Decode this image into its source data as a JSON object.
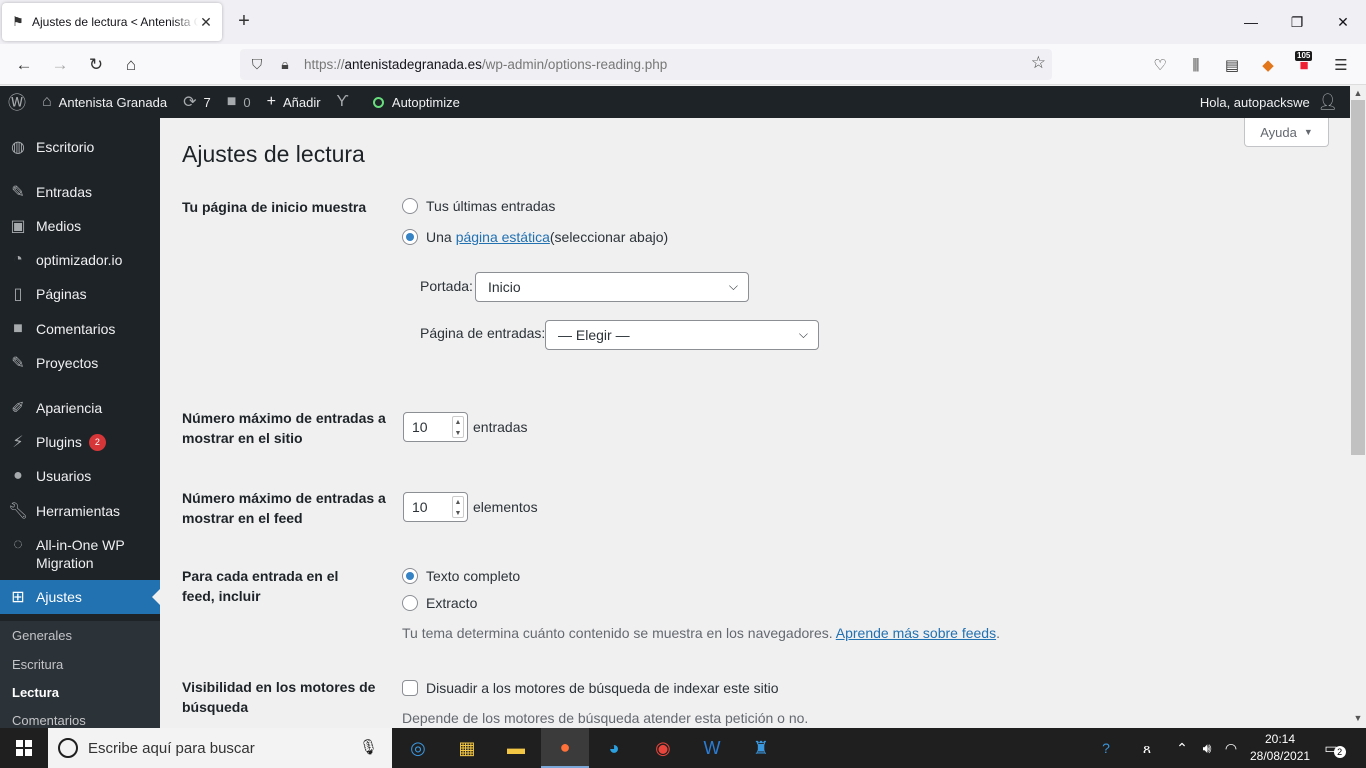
{
  "browser": {
    "tab_title": "Ajustes de lectura < Antenista Granada",
    "url_prefix": "https://",
    "url_domain": "antenistadegranada.es",
    "url_path": "/wp-admin/options-reading.php",
    "extension_badge": "105"
  },
  "adminbar": {
    "site_name": "Antenista Granada",
    "updates_count": "7",
    "comments_count": "0",
    "add_new": "Añadir",
    "autoptimize": "Autoptimize",
    "greeting": "Hola, autopackswe"
  },
  "sidebar": {
    "items": [
      {
        "label": "Escritorio"
      },
      {
        "label": "Entradas"
      },
      {
        "label": "Medios"
      },
      {
        "label": "optimizador.io"
      },
      {
        "label": "Páginas"
      },
      {
        "label": "Comentarios"
      },
      {
        "label": "Proyectos"
      },
      {
        "label": "Apariencia"
      },
      {
        "label": "Plugins",
        "badge": "2"
      },
      {
        "label": "Usuarios"
      },
      {
        "label": "Herramientas"
      },
      {
        "label": "All-in-One WP Migration"
      },
      {
        "label": "Ajustes"
      }
    ],
    "submenu": [
      "Generales",
      "Escritura",
      "Lectura",
      "Comentarios"
    ]
  },
  "page": {
    "help_label": "Ayuda",
    "title": "Ajustes de lectura",
    "homepage_label": "Tu página de inicio muestra",
    "opt_latest": "Tus últimas entradas",
    "opt_static_prefix": "Una ",
    "opt_static_link": "página estática",
    "opt_static_suffix": " (seleccionar abajo)",
    "front_label": "Portada:",
    "front_value": "Inicio",
    "posts_page_label": "Página de entradas:",
    "posts_page_value": "— Elegir —",
    "max_posts_label": "Número máximo de entradas a mostrar en el sitio",
    "max_posts_value": "10",
    "max_posts_unit": "entradas",
    "max_feed_label": "Número máximo de entradas a mostrar en el feed",
    "max_feed_value": "10",
    "max_feed_unit": "elementos",
    "feed_include_label": "Para cada entrada en el feed, incluir",
    "opt_full": "Texto completo",
    "opt_excerpt": "Extracto",
    "feed_desc_prefix": "Tu tema determina cuánto contenido se muestra en los navegadores. ",
    "feed_desc_link": "Aprende más sobre feeds",
    "feed_desc_suffix": ".",
    "visibility_label": "Visibilidad en los motores de búsqueda",
    "discourage_label": "Disuadir a los motores de búsqueda de indexar este sitio",
    "visibility_desc": "Depende de los motores de búsqueda atender esta petición o no."
  },
  "taskbar": {
    "search_placeholder": "Escribe aquí para buscar",
    "time": "20:14",
    "date": "28/08/2021",
    "notifications": "2"
  }
}
